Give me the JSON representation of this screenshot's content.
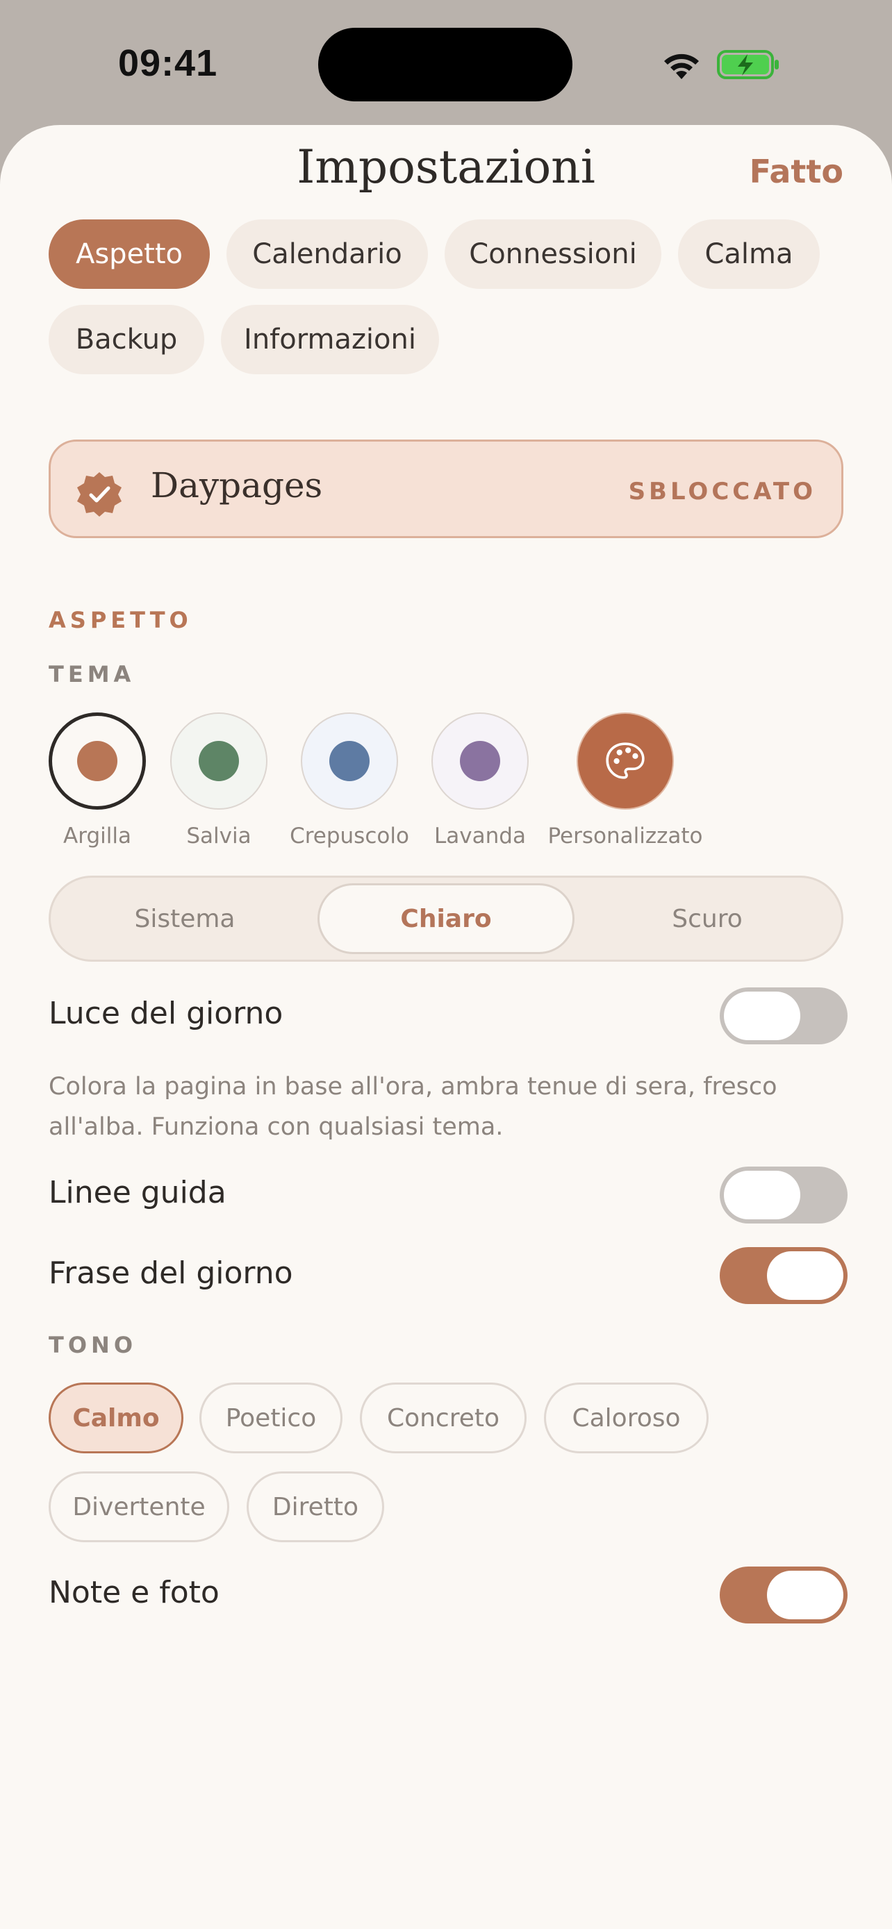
{
  "status": {
    "time": "09:41"
  },
  "header": {
    "title": "Impostazioni",
    "done_label": "Fatto"
  },
  "tabs": [
    {
      "label": "Aspetto",
      "active": true
    },
    {
      "label": "Calendario"
    },
    {
      "label": "Connessioni"
    },
    {
      "label": "Calma"
    },
    {
      "label": "Backup"
    },
    {
      "label": "Informazioni"
    }
  ],
  "unlock": {
    "name": "Daypages",
    "status": "SBLOCCATO"
  },
  "appearance": {
    "section_label": "ASPETTO",
    "theme_label": "TEMA",
    "themes": [
      {
        "label": "Argilla",
        "color": "#b87656",
        "selected": true
      },
      {
        "label": "Salvia",
        "color": "#5e8566"
      },
      {
        "label": "Crepuscolo",
        "color": "#5e7ba3"
      },
      {
        "label": "Lavanda",
        "color": "#8a73a0"
      },
      {
        "label": "Personalizzato",
        "color": "#b86a48",
        "icon": "palette-icon"
      }
    ],
    "mode_options": [
      "Sistema",
      "Chiaro",
      "Scuro"
    ],
    "mode_selected": "Chiaro"
  },
  "toggles": {
    "daylight": {
      "label": "Luce del giorno",
      "on": false,
      "description": "Colora la pagina in base all'ora, ambra tenue di sera, fresco all'alba. Funziona con qualsiasi tema."
    },
    "guidelines": {
      "label": "Linee guida",
      "on": false
    },
    "quote": {
      "label": "Frase del giorno",
      "on": true
    },
    "notes": {
      "label": "Note e foto",
      "on": true
    }
  },
  "tone": {
    "label": "TONO",
    "options": [
      "Calmo",
      "Poetico",
      "Concreto",
      "Caloroso",
      "Divertente",
      "Diretto"
    ],
    "selected": "Calmo"
  },
  "colors": {
    "accent": "#b87656",
    "background": "#fbf8f4",
    "chip_bg": "#f3ebe4"
  }
}
